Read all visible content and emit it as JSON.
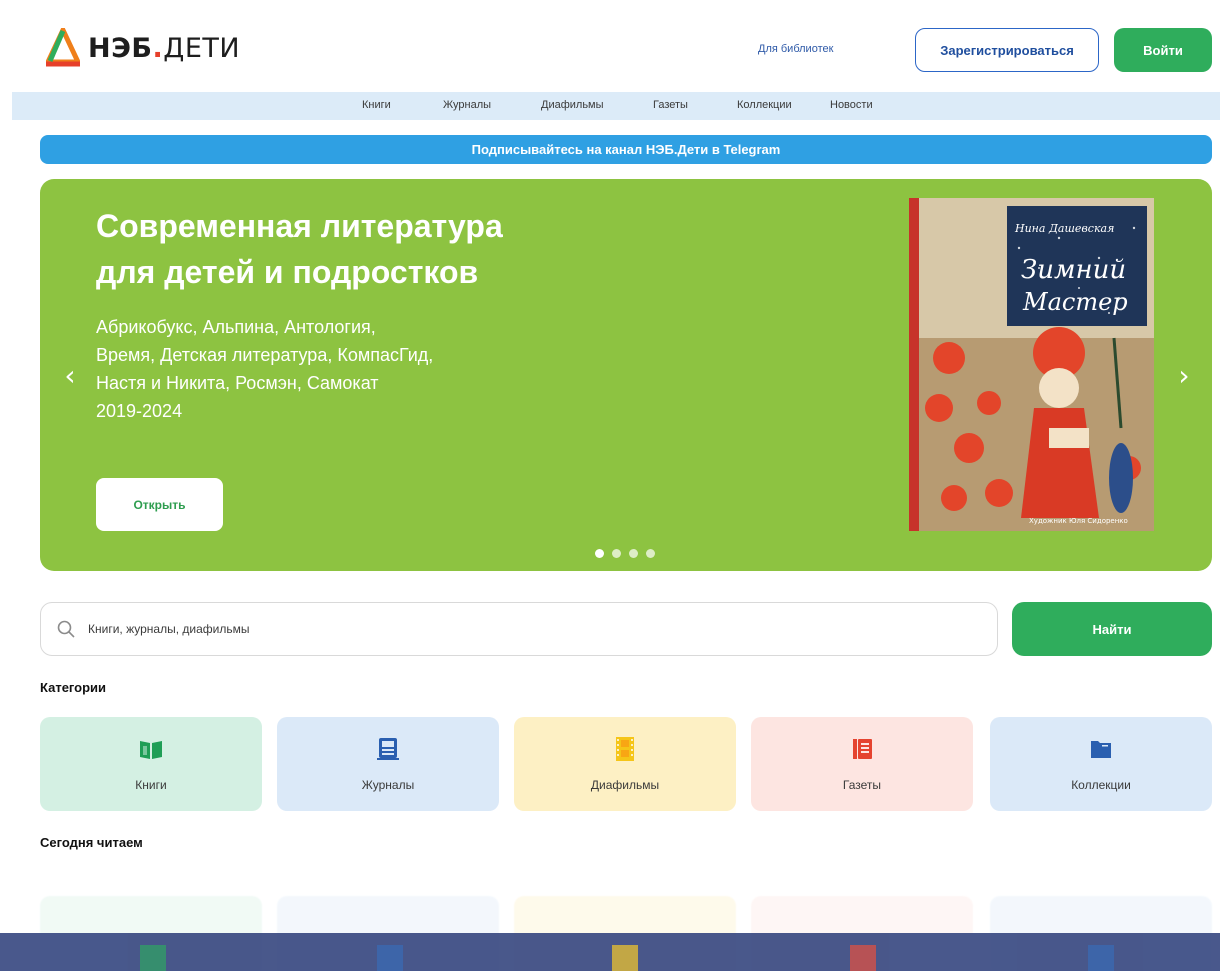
{
  "header": {
    "logo_main": "НЭБ",
    "logo_dot": ".",
    "logo_suffix": "ДЕТИ",
    "for_libraries": "Для библиотек",
    "register_label": "Зарегистрироваться",
    "login_label": "Войти"
  },
  "nav": {
    "items": [
      "Книги",
      "Журналы",
      "Диафильмы",
      "Газеты",
      "Коллекции",
      "Новости"
    ]
  },
  "telegram_banner": "Подписывайтесь на канал НЭБ.Дети в Telegram",
  "hero": {
    "title_line1": "Современная литература",
    "title_line2": "для детей и подростков",
    "sub_line1": "Абрикобукс, Альпина, Антология,",
    "sub_line2": "Время, Детская литература, КомпасГид,",
    "sub_line3": "Настя и Никита, Росмэн, Самокат",
    "sub_line4": "2019-2024",
    "open_label": "Открыть",
    "slides_total": 4,
    "active_slide": 1,
    "cover": {
      "author": "Нина Дашевская",
      "title_line1": "Зимний",
      "title_line2": "Мастер",
      "illustrator": "Художник Юля Сидоренко"
    }
  },
  "search": {
    "placeholder": "Книги, журналы, диафильмы",
    "value": "",
    "button_label": "Найти"
  },
  "categories": {
    "title": "Категории",
    "items": [
      {
        "label": "Книги",
        "icon": "book-icon",
        "bg": "#d4f0e3",
        "color": "#1f9e56"
      },
      {
        "label": "Журналы",
        "icon": "magazine-icon",
        "bg": "#dbe9f8",
        "color": "#2a5fb0"
      },
      {
        "label": "Диафильмы",
        "icon": "filmstrip-icon",
        "bg": "#fdf0c4",
        "color": "#f5c518"
      },
      {
        "label": "Газеты",
        "icon": "newspaper-icon",
        "bg": "#fde5e1",
        "color": "#e5432f"
      },
      {
        "label": "Коллекции",
        "icon": "folder-icon",
        "bg": "#dbe9f8",
        "color": "#2a5fb0"
      }
    ]
  },
  "today_reading": {
    "title": "Сегодня читаем"
  },
  "colors": {
    "brand_green": "#2fad5c",
    "hero_green": "#8dc341",
    "telegram_blue": "#2fa0e3",
    "nav_bg": "#dcebf8",
    "logo_red": "#e6402b"
  }
}
